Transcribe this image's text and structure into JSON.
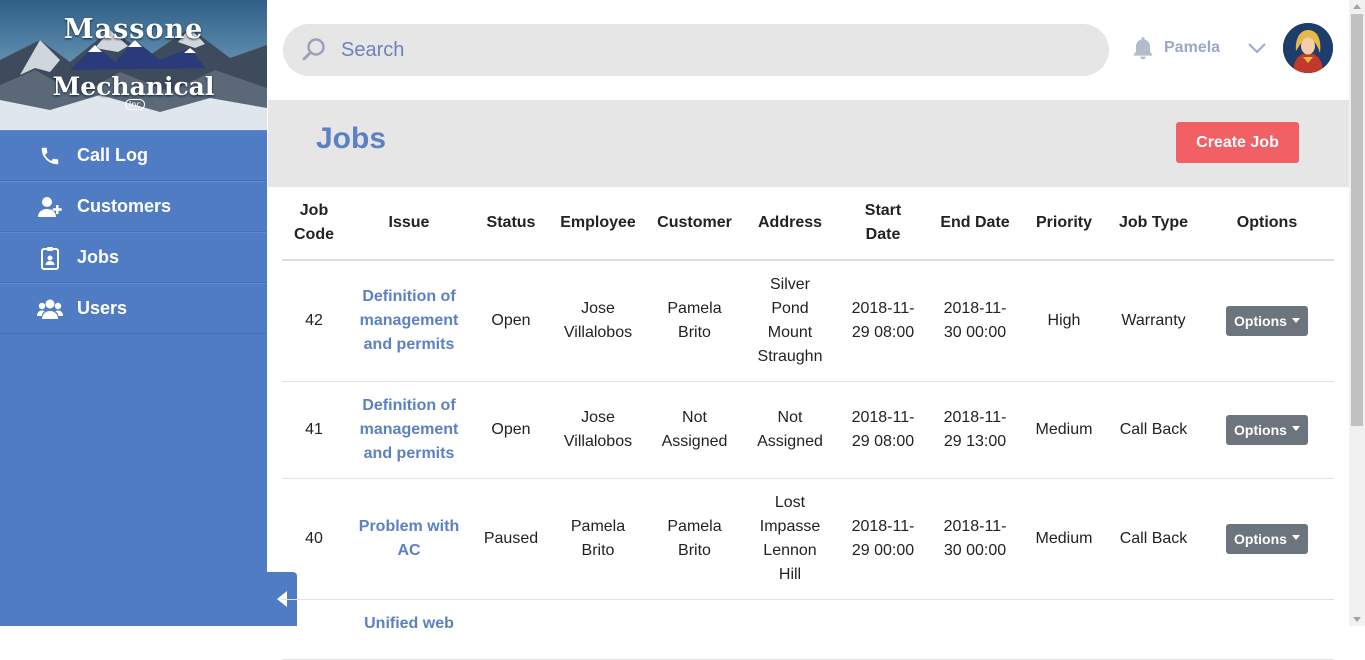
{
  "brand": {
    "line1": "Massone",
    "line2": "Mechanical",
    "inc": "Inc"
  },
  "sidebar": {
    "items": [
      {
        "label": "Call Log",
        "icon": "phone-icon"
      },
      {
        "label": "Customers",
        "icon": "add-user-icon"
      },
      {
        "label": "Jobs",
        "icon": "clipboard-icon"
      },
      {
        "label": "Users",
        "icon": "users-icon"
      }
    ]
  },
  "header": {
    "search_placeholder": "Search",
    "username": "Pamela"
  },
  "main": {
    "title": "Jobs",
    "create_label": "Create Job"
  },
  "table": {
    "headers": [
      "Job Code",
      "Issue",
      "Status",
      "Employee",
      "Customer",
      "Address",
      "Start Date",
      "End Date",
      "Priority",
      "Job Type",
      "Options"
    ],
    "rows": [
      {
        "code": "42",
        "issue": "Definition of management and permits",
        "status": "Open",
        "employee": "Jose Villalobos",
        "customer": "Pamela Brito",
        "address": "Silver Pond Mount Straughn",
        "start": "2018-11-29 08:00",
        "end": "2018-11-30 00:00",
        "priority": "High",
        "type": "Warranty",
        "options": "Options"
      },
      {
        "code": "41",
        "issue": "Definition of management and permits",
        "status": "Open",
        "employee": "Jose Villalobos",
        "customer": "Not Assigned",
        "address": "Not Assigned",
        "start": "2018-11-29 08:00",
        "end": "2018-11-29 13:00",
        "priority": "Medium",
        "type": "Call Back",
        "options": "Options"
      },
      {
        "code": "40",
        "issue": "Problem with AC",
        "status": "Paused",
        "employee": "Pamela Brito",
        "customer": "Pamela Brito",
        "address": "Lost Impasse Lennon Hill",
        "start": "2018-11-29 00:00",
        "end": "2018-11-30 00:00",
        "priority": "Medium",
        "type": "Call Back",
        "options": "Options"
      },
      {
        "code": "",
        "issue": "Unified web",
        "status": "",
        "employee": "",
        "customer": "",
        "address": "",
        "start": "",
        "end": "",
        "priority": "",
        "type": "",
        "options": ""
      }
    ]
  },
  "colors": {
    "sidebar": "#4f7cc3",
    "accent": "#5b80c4",
    "create_button": "#f06065",
    "options_button": "#6c757d"
  }
}
